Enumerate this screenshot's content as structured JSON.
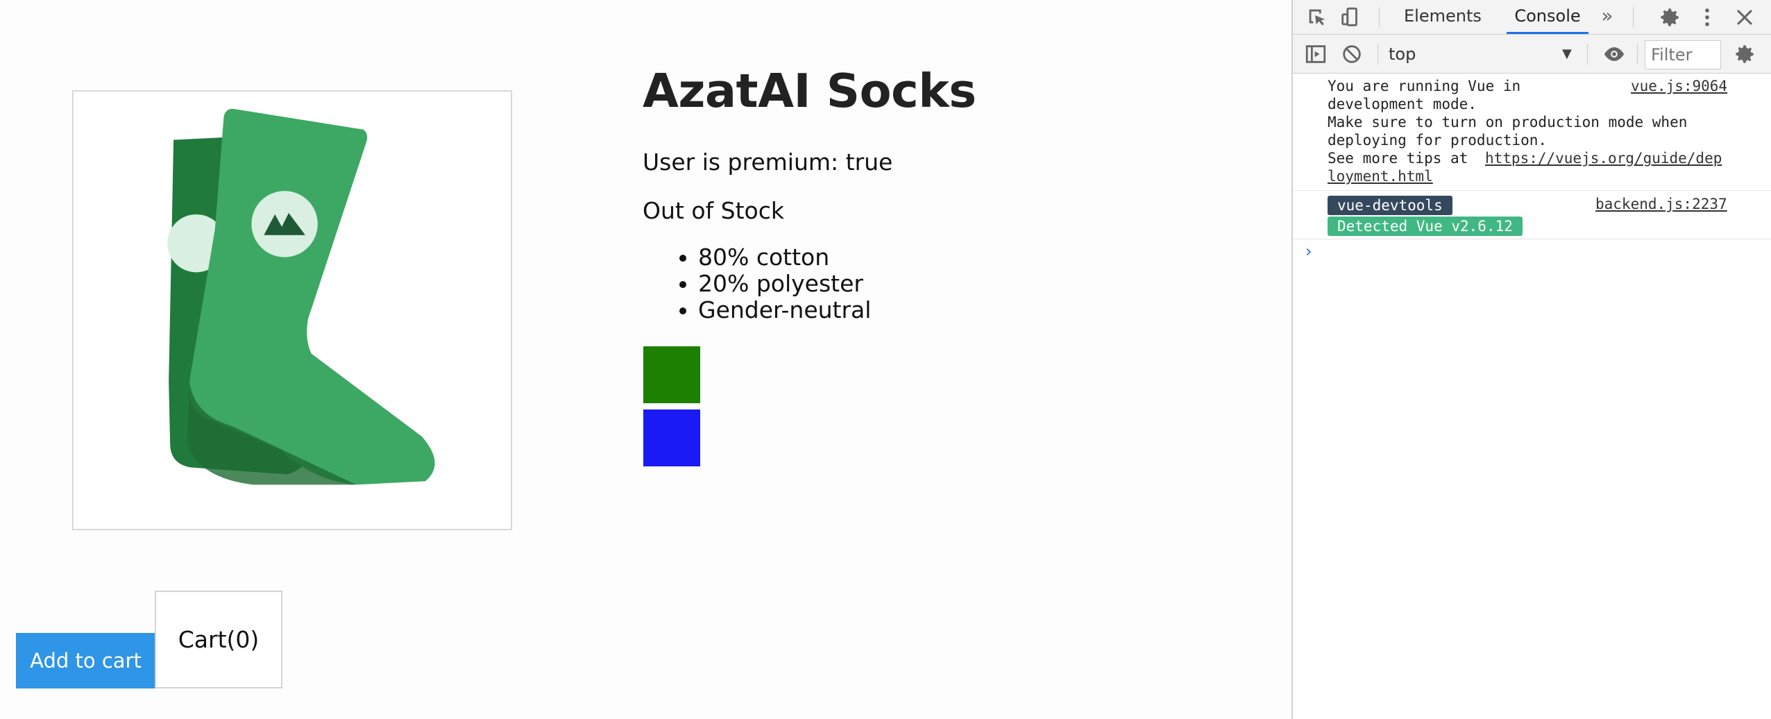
{
  "app": {
    "product_title": "AzatAI Socks",
    "premium_text": "User is premium: true",
    "stock_text": "Out of Stock",
    "details": [
      "80% cotton",
      "20% polyester",
      "Gender-neutral"
    ],
    "variant_colors": [
      "#1e8000",
      "#1a1af5"
    ],
    "add_to_cart_label": "Add to cart",
    "cart_label": "Cart(0)",
    "sock_color": "#3da863",
    "button_color": "#2f95e6"
  },
  "devtools": {
    "tabs": [
      "Elements",
      "Console"
    ],
    "active_tab": "Console",
    "more_tabs_icon": "double-chevron-icon",
    "context": "top",
    "filter_placeholder": "Filter",
    "filter_overflow": "[",
    "logs": [
      {
        "lines": [
          "You are running Vue in",
          "development mode.",
          "Make sure to turn on production mode when",
          "deploying for production.",
          "See more tips at "
        ],
        "link": "https://vuejs.org/guide/dep",
        "link_cont": "loyment.html",
        "source": "vue.js:9064"
      },
      {
        "badge1": "vue-devtools",
        "badge2": "Detected Vue v2.6.12",
        "source": "backend.js:2237",
        "badge1_color": "#35495e",
        "badge2_color": "#41b883"
      }
    ],
    "prompt_symbol": "›"
  }
}
